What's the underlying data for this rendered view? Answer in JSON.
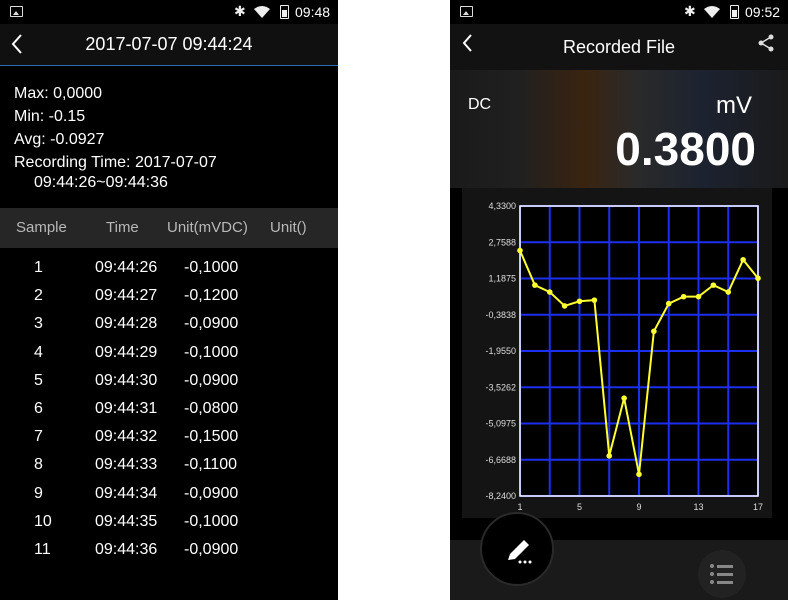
{
  "left": {
    "status_time": "09:48",
    "title": "2017-07-07 09:44:24",
    "stats": {
      "max": "Max:  0,0000",
      "min": "Min:  -0.15",
      "avg": "Avg:  -0.0927",
      "recording": "Recording Time: 2017-07-07",
      "range": "09:44:26~09:44:36"
    },
    "columns": [
      "Sample",
      "Time",
      "Unit(mVDC)",
      "Unit()"
    ],
    "rows": [
      [
        "1",
        "09:44:26",
        "-0,1000"
      ],
      [
        "2",
        "09:44:27",
        "-0,1200"
      ],
      [
        "3",
        "09:44:28",
        "-0,0900"
      ],
      [
        "4",
        "09:44:29",
        "-0,1000"
      ],
      [
        "5",
        "09:44:30",
        "-0,0900"
      ],
      [
        "6",
        "09:44:31",
        "-0,0800"
      ],
      [
        "7",
        "09:44:32",
        "-0,1500"
      ],
      [
        "8",
        "09:44:33",
        "-0,1100"
      ],
      [
        "9",
        "09:44:34",
        "-0,0900"
      ],
      [
        "10",
        "09:44:35",
        "-0,1000"
      ],
      [
        "11",
        "09:44:36",
        "-0,0900"
      ]
    ]
  },
  "right": {
    "status_time": "09:52",
    "title": "Recorded File",
    "mode": "DC",
    "unit": "mV",
    "value": "0.3800",
    "icons": [
      "back-icon",
      "share-icon",
      "edit-icon",
      "list-icon"
    ]
  },
  "colors": {
    "accent": "#2d6fb6",
    "chart_line": "#ffff33",
    "chart_grid": "#1c2ef0"
  },
  "chart_data": {
    "type": "line",
    "title": "",
    "xlabel": "",
    "ylabel": "",
    "xlim": [
      1,
      17
    ],
    "ylim": [
      -8.24,
      4.33
    ],
    "x_ticks": [
      "1",
      "5",
      "9",
      "13",
      "17"
    ],
    "y_ticks": [
      "4,3300",
      "2,7588",
      "1,1875",
      "-0,3838",
      "-1,9550",
      "-3,5262",
      "-5,0975",
      "-6,6688",
      "-8,2400"
    ],
    "grid": true,
    "series": [
      {
        "x": [
          1,
          2,
          3,
          4,
          5,
          6,
          7,
          8,
          9,
          10,
          11,
          12,
          13,
          14,
          15,
          16,
          17
        ],
        "values": [
          2.4,
          0.9,
          0.6,
          0.0,
          0.2,
          0.25,
          -6.5,
          -4.0,
          -7.3,
          -1.1,
          0.1,
          0.4,
          0.4,
          0.9,
          0.6,
          2.0,
          1.2
        ]
      }
    ]
  }
}
